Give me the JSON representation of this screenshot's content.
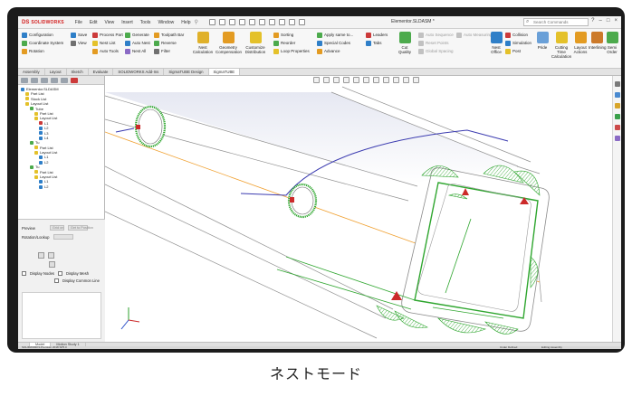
{
  "app": {
    "logo_ds": "DS",
    "logo_name": "SOLIDWORKS",
    "document_title": "Elementor.SLDASM *",
    "search_placeholder": "Search Commands",
    "menus": [
      "File",
      "Edit",
      "View",
      "Insert",
      "Tools",
      "Window",
      "Help"
    ],
    "window_controls": [
      "?",
      "–",
      "□",
      "×"
    ]
  },
  "command_manager": {
    "col1": [
      "Configuration",
      "Coordinate System",
      "Rotation"
    ],
    "col2": [
      "Save",
      "View"
    ],
    "col3": [
      "Process Part",
      "Nest List",
      "Auto Tools"
    ],
    "col4": [
      "Generate",
      "Auto Nest",
      "Nest All"
    ],
    "col5": [
      "Toolpath Bar",
      "Reverse",
      "Filter"
    ],
    "big1": "Nest Calculation",
    "big2": "Geometry Compensation",
    "big3": "Customize Distribution",
    "col6": [
      "Sorting",
      "Reorder",
      "Loop Properties"
    ],
    "col7": [
      "Apply same to...",
      "Special Codes",
      "Advance"
    ],
    "col8": [
      "Leaders",
      "Tabs"
    ],
    "big4": "Cut Quality",
    "col9": [
      "Auto Sequence",
      "Reset Points",
      "Global Spacing"
    ],
    "col10": [
      "Auto Measuring"
    ],
    "col11": [
      "Collision",
      "Simulation",
      "Post"
    ],
    "big5": "Nest Office",
    "big6": "Pride",
    "big7": "Cutting Time Calculation",
    "big8": "Layout Actions",
    "big9": "Interlining",
    "big10": "Semi Order"
  },
  "command_tabs": [
    {
      "label": "Assembly",
      "active": false
    },
    {
      "label": "Layout",
      "active": false
    },
    {
      "label": "Sketch",
      "active": false
    },
    {
      "label": "Evaluate",
      "active": false
    },
    {
      "label": "SOLIDWORKS Add-Ins",
      "active": false
    },
    {
      "label": "SigmaTUBE Design",
      "active": false
    },
    {
      "label": "SigmaTUBE",
      "active": true
    }
  ],
  "tree": [
    {
      "label": "Elementor.SLDASM",
      "level": 0,
      "color": "#2f7fc8"
    },
    {
      "label": "Part List",
      "level": 1,
      "color": "#e4c12a"
    },
    {
      "label": "Stock List",
      "level": 1,
      "color": "#e4c12a"
    },
    {
      "label": "Layout List",
      "level": 1,
      "color": "#e4c12a"
    },
    {
      "label": "Tube",
      "level": 2,
      "color": "#4caa4c"
    },
    {
      "label": "Part List",
      "level": 3,
      "color": "#e4c12a"
    },
    {
      "label": "Layout List",
      "level": 3,
      "color": "#e4c12a"
    },
    {
      "label": "L1",
      "level": 4,
      "color": "#cc3a3a"
    },
    {
      "label": "L2",
      "level": 4,
      "color": "#2f7fc8"
    },
    {
      "label": "L3",
      "level": 4,
      "color": "#2f7fc8"
    },
    {
      "label": "L4",
      "level": 4,
      "color": "#2f7fc8"
    },
    {
      "label": "Tu",
      "level": 2,
      "color": "#4caa4c"
    },
    {
      "label": "Part List",
      "level": 3,
      "color": "#e4c12a"
    },
    {
      "label": "Layout List",
      "level": 3,
      "color": "#e4c12a"
    },
    {
      "label": "L1",
      "level": 4,
      "color": "#2f7fc8"
    },
    {
      "label": "L2",
      "level": 4,
      "color": "#2f7fc8"
    },
    {
      "label": "Tu",
      "level": 2,
      "color": "#4caa4c"
    },
    {
      "label": "Part List",
      "level": 3,
      "color": "#e4c12a"
    },
    {
      "label": "Layout List",
      "level": 3,
      "color": "#e4c12a"
    },
    {
      "label": "L1",
      "level": 4,
      "color": "#2f7fc8"
    },
    {
      "label": "L2",
      "level": 4,
      "color": "#2f7fc8"
    }
  ],
  "properties": {
    "preview_label": "Preview",
    "preview_btn1": "Grid on",
    "preview_btn2": "Get to Position",
    "rotation_label": "Rotation/Lookup",
    "display_nodes": "Display Nodes",
    "display_mesh": "Display Mesh",
    "display_common_line": "Display Common Line"
  },
  "bottom_tabs": [
    {
      "label": "",
      "active": false
    },
    {
      "label": "Model",
      "active": true
    },
    {
      "label": "Motion Study 1",
      "active": false
    }
  ],
  "status": {
    "left": "SOLIDWORKS Premium 2018 SP5.0",
    "under_defined": "Under Defined",
    "editing": "Editing Assembly"
  },
  "caption": "ネストモード"
}
